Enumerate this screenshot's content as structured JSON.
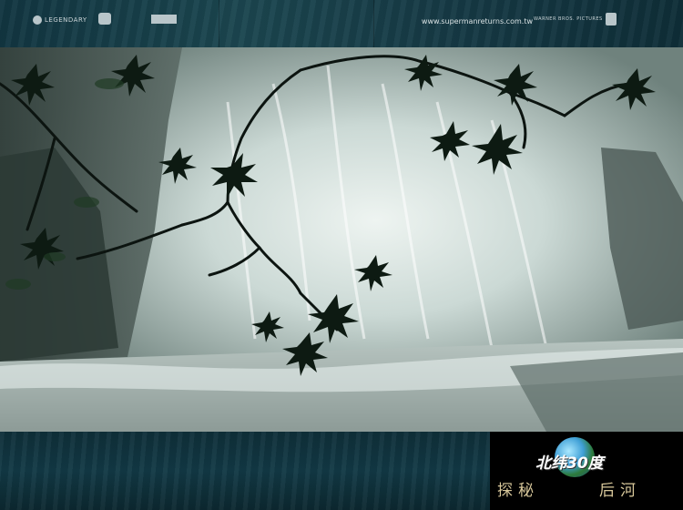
{
  "top_banner": {
    "logo_1_text": "LEGENDARY",
    "url": "www.supermanreturns.com.tw",
    "logo_right_text": "WARNER BROS. PICTURES"
  },
  "title_box": {
    "main_title": "北纬30度",
    "subtitle_left": "探秘",
    "subtitle_right": "后河"
  },
  "colors": {
    "banner": "#173c47",
    "title_box_bg": "#000000",
    "subtitle": "#d7c79a"
  }
}
